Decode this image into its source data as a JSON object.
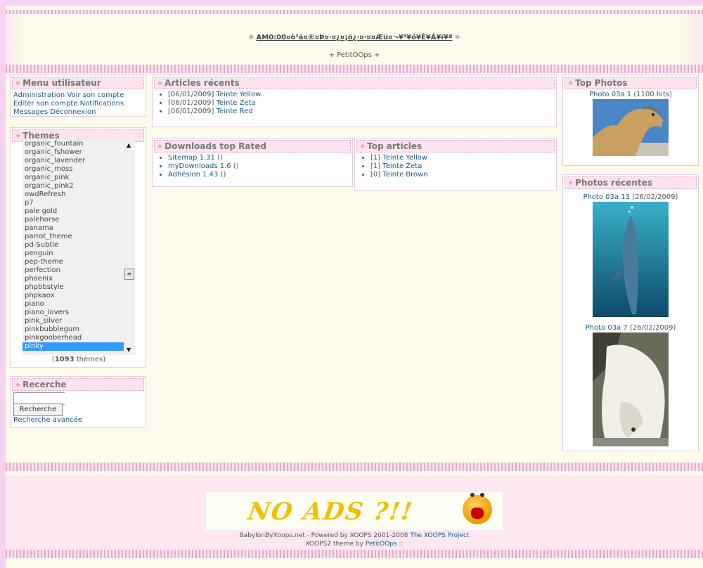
{
  "header": {
    "title": "AM0:00¤ò²á¤®¤Þ¤·¤¿¤¡ö¿·¤·¤¤Æü¤¬¥³¥ó¥È¥Á¥ï¥ª",
    "subtitle": "+ PetitOOps +"
  },
  "menu": {
    "title": "Menu utilisateur",
    "lines": [
      [
        "Administration",
        "Voir son compte"
      ],
      [
        "Editer son compte",
        "Notifications"
      ],
      [
        "Messages",
        "Déconnexion"
      ]
    ]
  },
  "themes": {
    "title": "Themes",
    "options": [
      "organic_fountain",
      "organic_fshower",
      "organic_lavender",
      "organic_moss",
      "organic_pink",
      "organic_pink2",
      "owdRefresh",
      "p7",
      "pale gold",
      "palehorse",
      "panama",
      "parrot_theme",
      "pd-Subtle",
      "penguin",
      "pep-theme",
      "perfection",
      "phoenix",
      "phpbbstyle",
      "phpkaox",
      "piano",
      "piano_lovers",
      "pink_silver",
      "pinkbubblegum",
      "pinkgooberhead",
      "pinky"
    ],
    "selected": "pinky",
    "count": "1093",
    "count_suffix": "thèmes"
  },
  "search": {
    "title": "Recerche",
    "button": "Recherche",
    "advanced": "Recherche avancée"
  },
  "articles": {
    "title": "Articles récents",
    "items": [
      {
        "date": "[06/01/2009]",
        "name": "Teinte Yellow"
      },
      {
        "date": "[06/01/2009]",
        "name": "Teinte Zeta"
      },
      {
        "date": "[06/01/2009]",
        "name": "Teinte Red"
      }
    ]
  },
  "downloads": {
    "title": "Downloads top Rated",
    "items": [
      {
        "name": "Sitemap 1.31",
        "extra": "()"
      },
      {
        "name": "myDownloads 1.6",
        "extra": "()"
      },
      {
        "name": "Adhésion 1.43",
        "extra": "()"
      }
    ]
  },
  "top_articles": {
    "title": "Top articles",
    "items": [
      {
        "count": "[1]",
        "name": "Teinte Yellow"
      },
      {
        "count": "[1]",
        "name": "Teinte Zeta"
      },
      {
        "count": "[0]",
        "name": "Teinte Brown"
      }
    ]
  },
  "top_photos": {
    "title": "Top Photos",
    "photo": {
      "name": "Photo 03a 1",
      "meta": "(1100 hits)"
    }
  },
  "recent_photos": {
    "title": "Photos récentes",
    "photos": [
      {
        "name": "Photo 03a 13",
        "meta": "(26/02/2009)"
      },
      {
        "name": "Photo 03a 7",
        "meta": "(26/02/2009)"
      }
    ]
  },
  "ads": {
    "text": "NO ADS ?!!"
  },
  "footer": {
    "line1_prefix": "BabylonByXoops.net - Powered by XOOPS 2001-2008",
    "line1_link": "The XOOPS Project",
    "line2_prefix": "XOOPS2 theme by",
    "line2_link": "PetitOOps",
    "line2_suffix": "::"
  },
  "colors": {
    "accent": "#e58fb3",
    "link": "#1a5a8a",
    "background": "#fdfbeb",
    "frame": "#f7d3f3"
  }
}
